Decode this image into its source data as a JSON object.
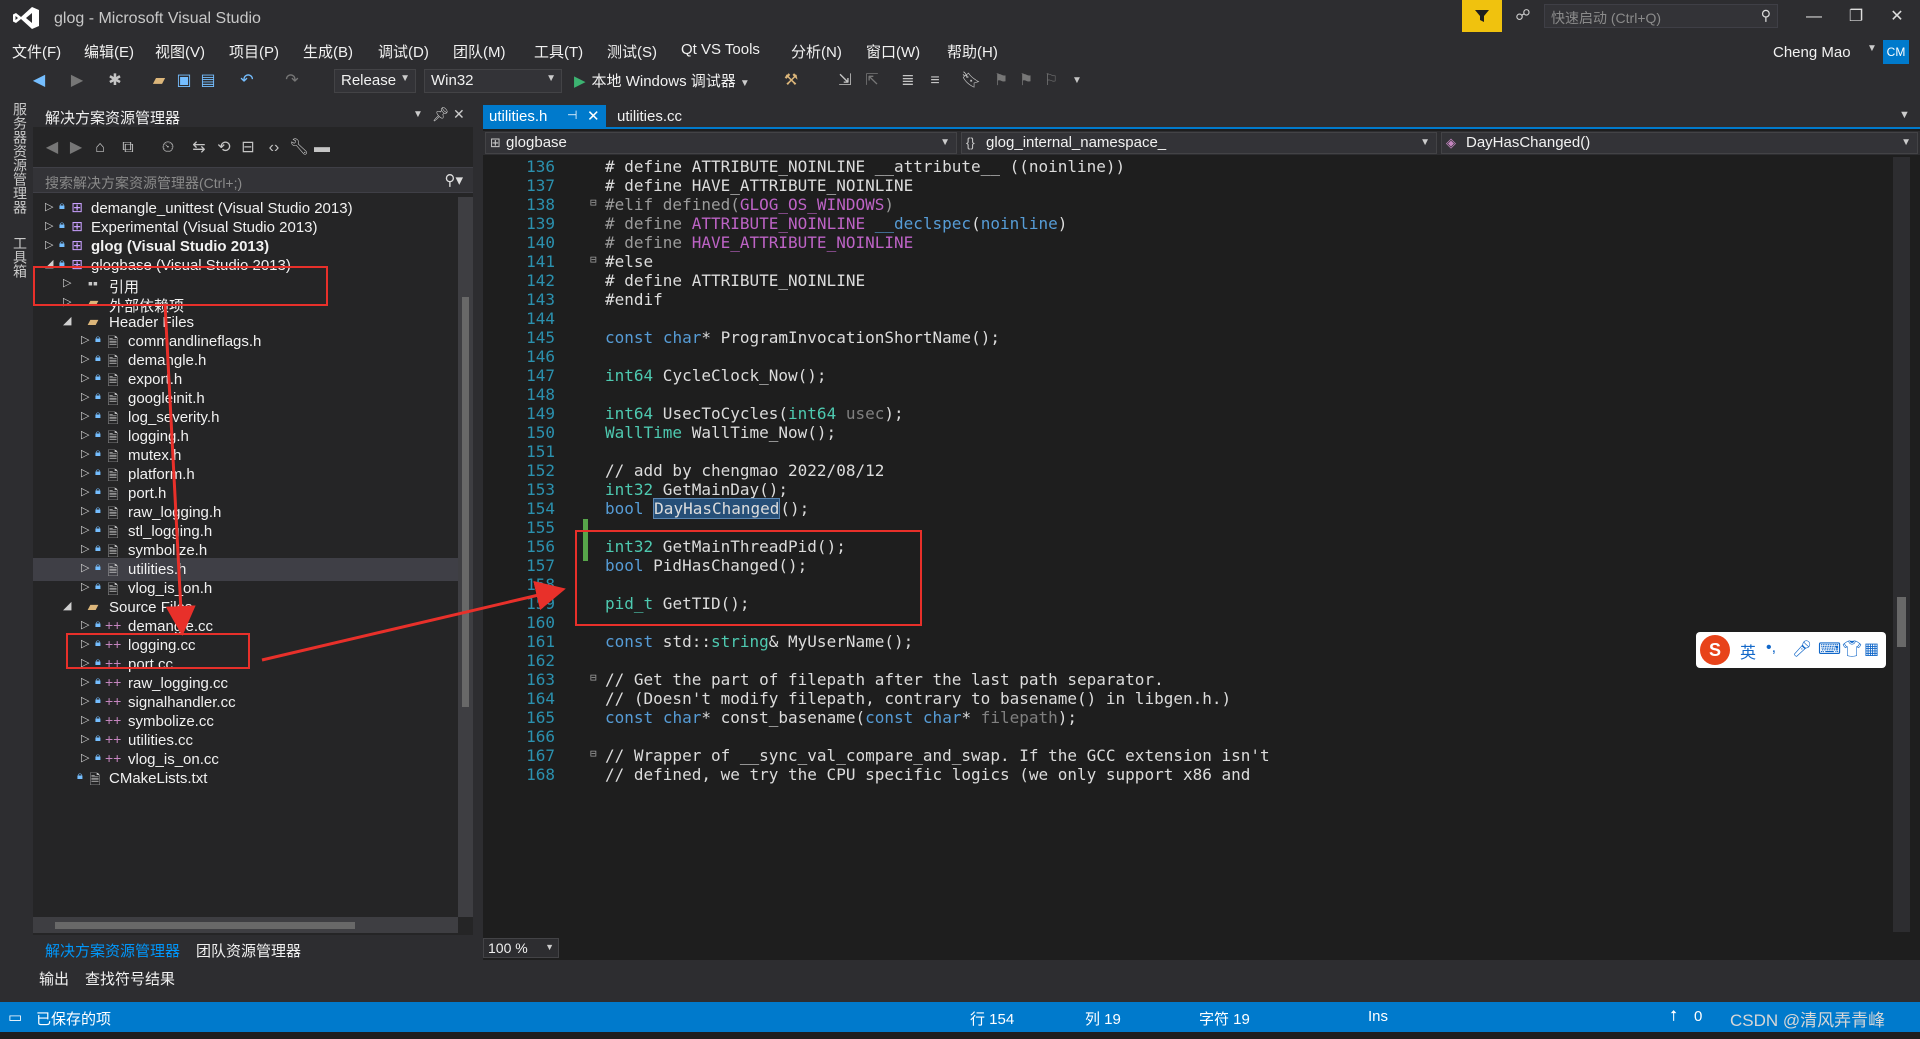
{
  "window": {
    "title": "glog - Microsoft Visual Studio",
    "quick_launch_placeholder": "快速启动 (Ctrl+Q)"
  },
  "menu": {
    "items": [
      "文件(F)",
      "编辑(E)",
      "视图(V)",
      "项目(P)",
      "生成(B)",
      "调试(D)",
      "团队(M)",
      "工具(T)",
      "测试(S)",
      "Qt VS Tools",
      "分析(N)",
      "窗口(W)",
      "帮助(H)"
    ]
  },
  "user": {
    "name": "Cheng Mao",
    "initials": "CM"
  },
  "toolbar": {
    "configuration": "Release",
    "platform": "Win32",
    "run_label": "本地 Windows 调试器"
  },
  "left_strip": {
    "tabs": [
      "服务器资源管理器",
      "工具箱"
    ]
  },
  "solution_explorer": {
    "title": "解决方案资源管理器",
    "search_placeholder": "搜索解决方案资源管理器(Ctrl+;)",
    "items": [
      {
        "label": "demangle_unittest (Visual Studio 2013)",
        "kind": "project"
      },
      {
        "label": "Experimental (Visual Studio 2013)",
        "kind": "project"
      },
      {
        "label": "glog (Visual Studio 2013)",
        "kind": "project"
      },
      {
        "label": "glogbase (Visual Studio 2013)",
        "kind": "project"
      },
      {
        "label": "引用",
        "kind": "reference"
      },
      {
        "label": "外部依赖项",
        "kind": "folder"
      },
      {
        "label": "Header Files",
        "kind": "folder"
      },
      {
        "label": "commandlineflags.h",
        "kind": "header"
      },
      {
        "label": "demangle.h",
        "kind": "header"
      },
      {
        "label": "export.h",
        "kind": "header"
      },
      {
        "label": "googleinit.h",
        "kind": "header"
      },
      {
        "label": "log_severity.h",
        "kind": "header"
      },
      {
        "label": "logging.h",
        "kind": "header"
      },
      {
        "label": "mutex.h",
        "kind": "header"
      },
      {
        "label": "platform.h",
        "kind": "header"
      },
      {
        "label": "port.h",
        "kind": "header"
      },
      {
        "label": "raw_logging.h",
        "kind": "header"
      },
      {
        "label": "stl_logging.h",
        "kind": "header"
      },
      {
        "label": "symbolize.h",
        "kind": "header"
      },
      {
        "label": "utilities.h",
        "kind": "header"
      },
      {
        "label": "vlog_is_on.h",
        "kind": "header"
      },
      {
        "label": "Source Files",
        "kind": "folder"
      },
      {
        "label": "demangle.cc",
        "kind": "source"
      },
      {
        "label": "logging.cc",
        "kind": "source"
      },
      {
        "label": "port.cc",
        "kind": "source"
      },
      {
        "label": "raw_logging.cc",
        "kind": "source"
      },
      {
        "label": "signalhandler.cc",
        "kind": "source"
      },
      {
        "label": "symbolize.cc",
        "kind": "source"
      },
      {
        "label": "utilities.cc",
        "kind": "source"
      },
      {
        "label": "vlog_is_on.cc",
        "kind": "source"
      },
      {
        "label": "CMakeLists.txt",
        "kind": "text"
      }
    ],
    "bottom_tabs": [
      "解决方案资源管理器",
      "团队资源管理器"
    ]
  },
  "output_tabs": [
    "输出",
    "查找符号结果"
  ],
  "editor": {
    "tabs": [
      "utilities.h",
      "utilities.cc"
    ],
    "nav": {
      "project": "glogbase",
      "scope": "glog_internal_namespace_",
      "member": "DayHasChanged()"
    },
    "line_numbers": [
      "136",
      "137",
      "138",
      "139",
      "140",
      "141",
      "142",
      "143",
      "144",
      "145",
      "146",
      "147",
      "148",
      "149",
      "150",
      "151",
      "152",
      "153",
      "154",
      "155",
      "156",
      "157",
      "158",
      "159",
      "160",
      "161",
      "162",
      "163",
      "164",
      "165",
      "166",
      "167",
      "168"
    ],
    "zoom": "100 %"
  },
  "status": {
    "saved": "已保存的项",
    "line": "行 154",
    "col": "列 19",
    "char": "字符 19",
    "mode": "Ins",
    "publish_count": "0"
  },
  "ime": {
    "logo": "S",
    "lang": "英"
  },
  "watermark": "CSDN @清风弄青峰"
}
